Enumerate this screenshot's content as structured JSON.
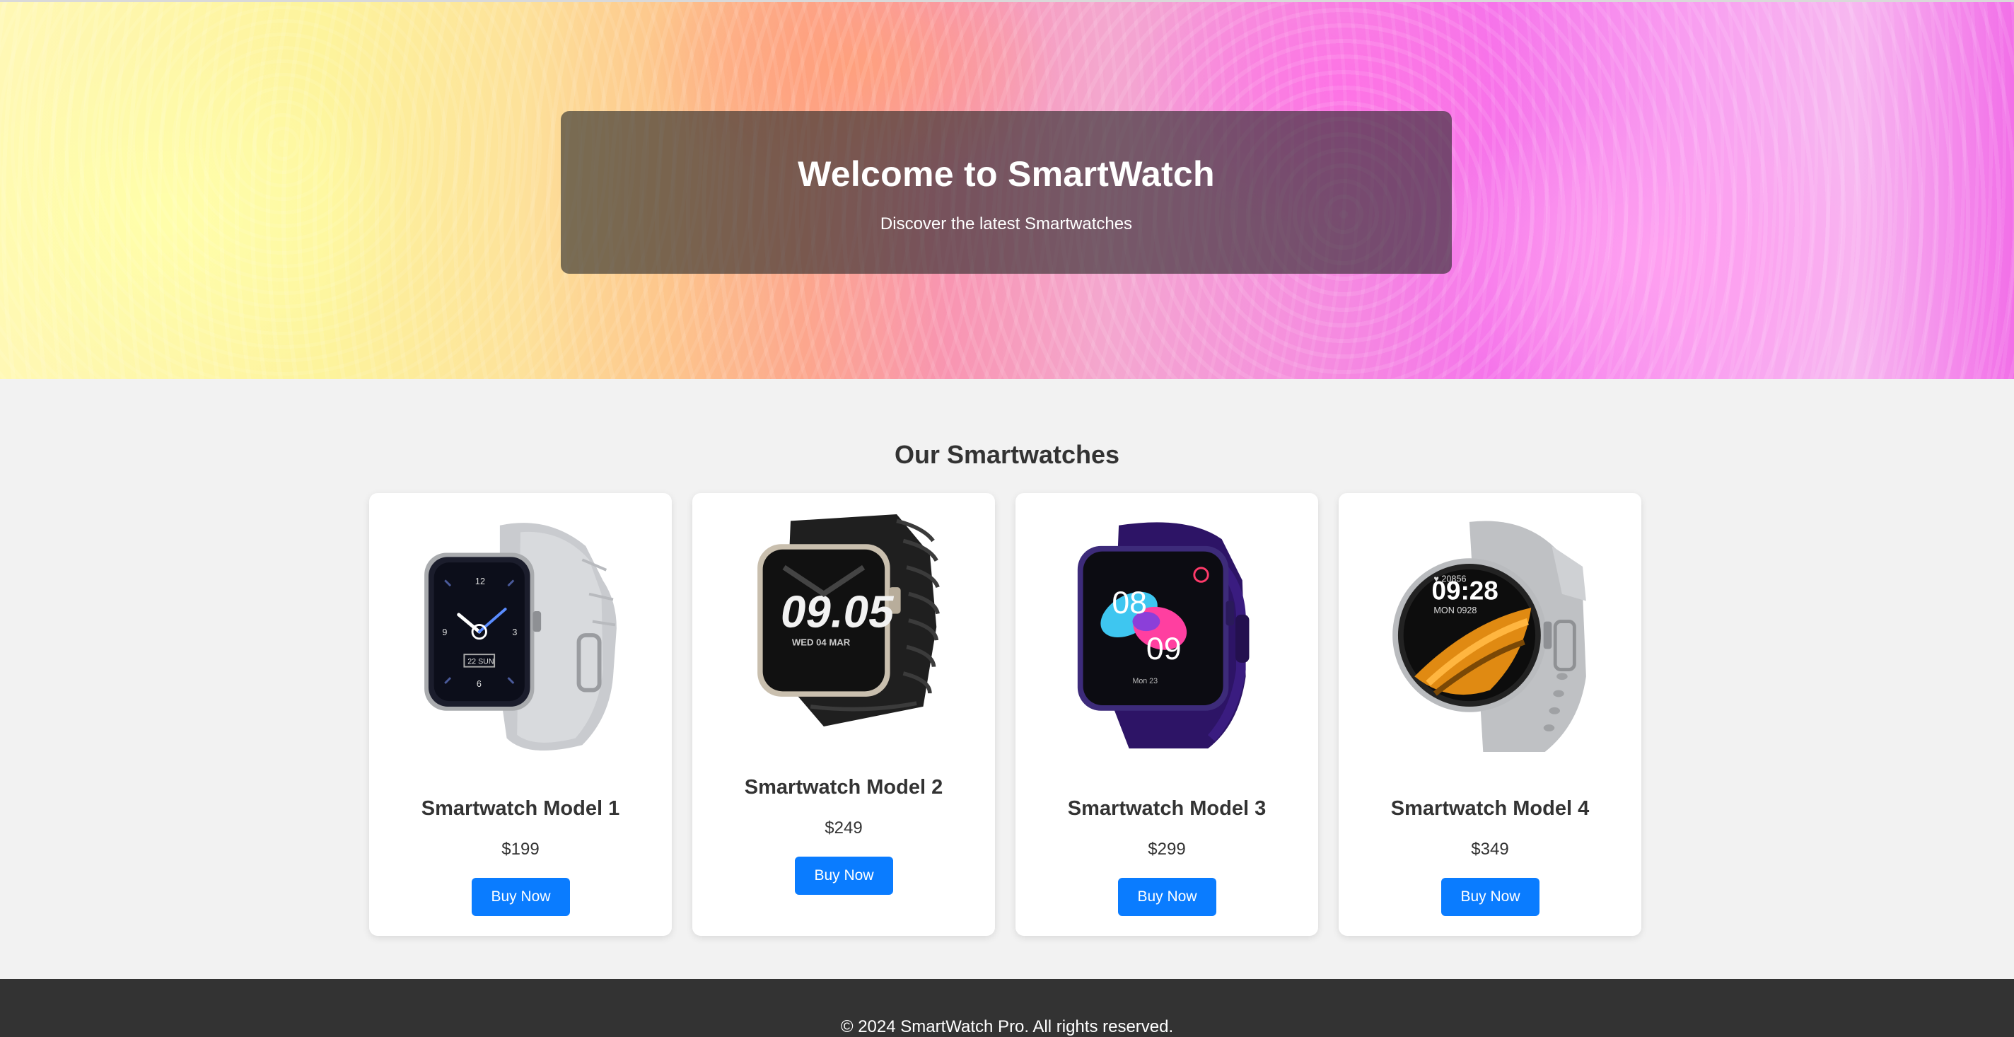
{
  "hero": {
    "title": "Welcome to SmartWatch",
    "subtitle": "Discover the latest Smartwatches"
  },
  "products_section": {
    "title": "Our Smartwatches",
    "products": [
      {
        "name": "Smartwatch Model 1",
        "price": "$199",
        "button": "Buy Now",
        "image_icon": "silver-square-watch-icon",
        "face_text": "22 SUN"
      },
      {
        "name": "Smartwatch Model 2",
        "price": "$249",
        "button": "Buy Now",
        "image_icon": "black-rugged-watch-icon",
        "face_text": "09.05"
      },
      {
        "name": "Smartwatch Model 3",
        "price": "$299",
        "button": "Buy Now",
        "image_icon": "purple-square-watch-icon",
        "face_text": "08 09",
        "face_subtext": "Mon 23"
      },
      {
        "name": "Smartwatch Model 4",
        "price": "$349",
        "button": "Buy Now",
        "image_icon": "silver-round-watch-icon",
        "face_text": "09:28",
        "face_subtext": "MON 0928"
      }
    ]
  },
  "footer": {
    "text": "© 2024 SmartWatch Pro. All rights reserved."
  },
  "colors": {
    "button": "#0a7cff",
    "footer_bg": "#333333",
    "page_bg": "#f2f2f2",
    "hero_box_bg": "rgba(40,40,40,0.62)"
  }
}
